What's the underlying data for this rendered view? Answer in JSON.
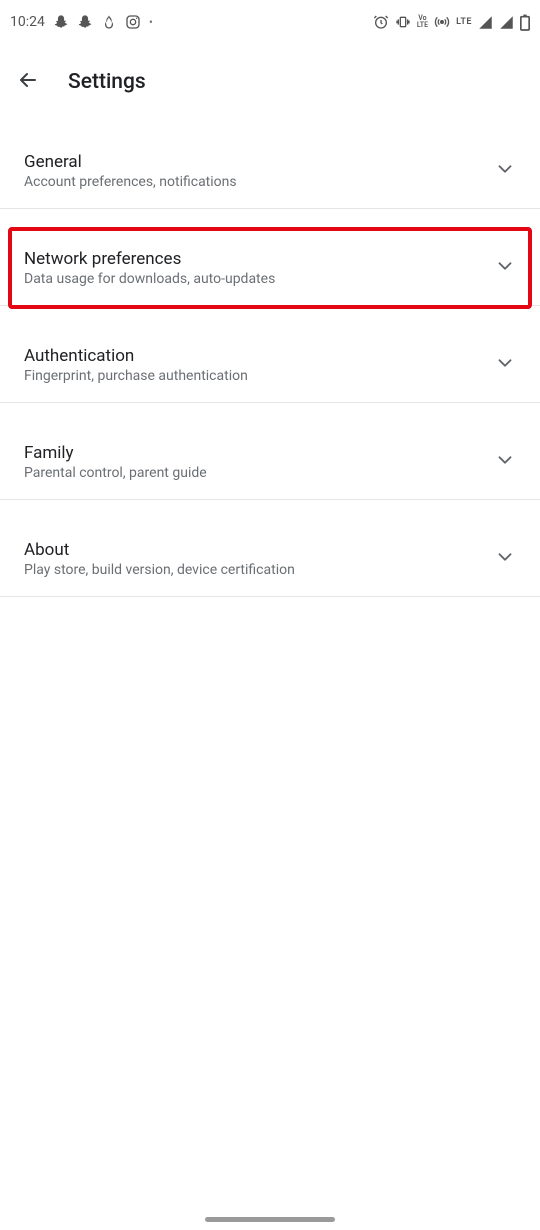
{
  "status": {
    "time": "10:24",
    "lte": "LTE",
    "volte": "Vo\nLTE"
  },
  "header": {
    "title": "Settings"
  },
  "settings": [
    {
      "title": "General",
      "subtitle": "Account preferences, notifications",
      "highlighted": false
    },
    {
      "title": "Network preferences",
      "subtitle": "Data usage for downloads, auto-updates",
      "highlighted": true
    },
    {
      "title": "Authentication",
      "subtitle": "Fingerprint, purchase authentication",
      "highlighted": false
    },
    {
      "title": "Family",
      "subtitle": "Parental control, parent guide",
      "highlighted": false
    },
    {
      "title": "About",
      "subtitle": "Play store, build version, device certification",
      "highlighted": false
    }
  ]
}
